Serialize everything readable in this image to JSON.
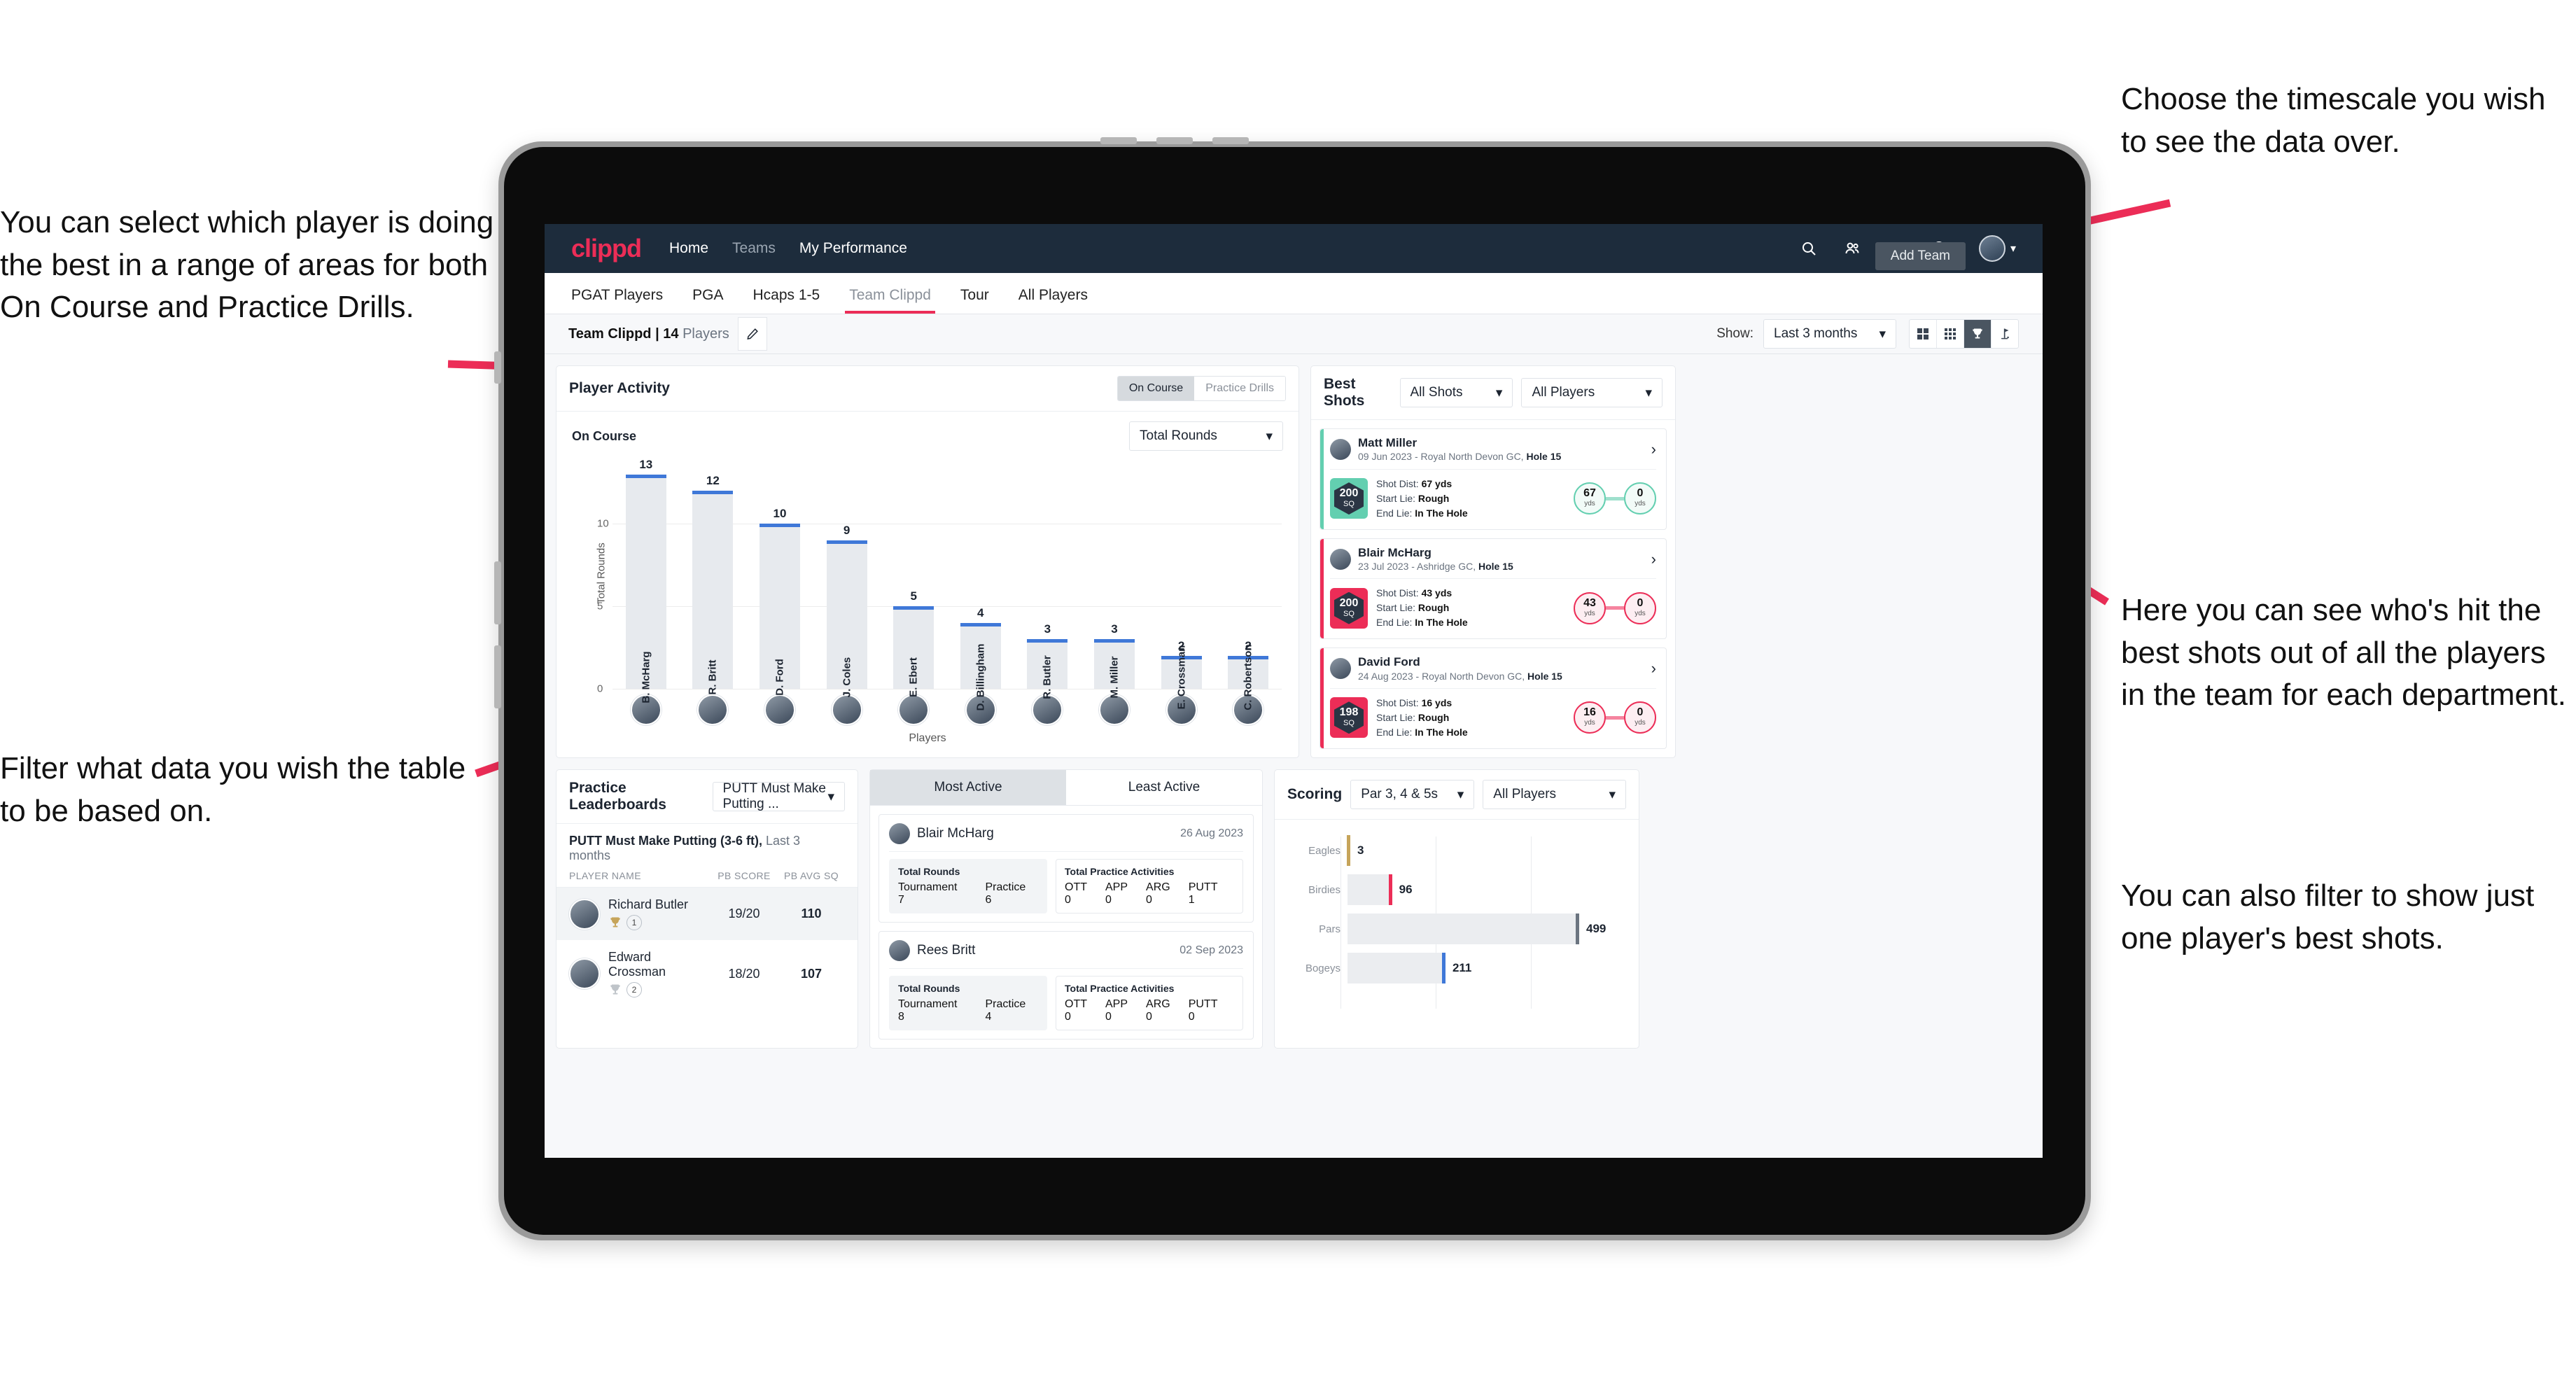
{
  "annotations": {
    "left_top": "You can select which player is doing the best in a range of areas for both On Course and Practice Drills.",
    "left_bottom": "Filter what data you wish the table to be based on.",
    "right_top": "Choose the timescale you wish to see the data over.",
    "right_mid": "Here you can see who's hit the best shots out of all the players in the team for each department.",
    "right_bottom": "You can also filter to show just one player's best shots."
  },
  "colors": {
    "brand": "#ec2d57",
    "navy": "#1d2c3c",
    "teal": "#63cfb0",
    "blue": "#3f78d8",
    "gold": "#c6a45a"
  },
  "topnav": {
    "brand": "clippd",
    "links": [
      {
        "label": "Home"
      },
      {
        "label": "Teams"
      },
      {
        "label": "My Performance"
      }
    ],
    "icons": [
      "search-icon",
      "people-icon",
      "bell-icon",
      "plus-circle-icon",
      "avatar"
    ]
  },
  "tabs": [
    {
      "label": "PGAT Players",
      "active": false
    },
    {
      "label": "PGA",
      "active": false
    },
    {
      "label": "Hcaps 1-5",
      "active": false
    },
    {
      "label": "Team Clippd",
      "active": true
    },
    {
      "label": "Tour",
      "active": false
    },
    {
      "label": "All Players",
      "active": false
    }
  ],
  "tooltip": {
    "add_team": "Add Team"
  },
  "subbar": {
    "team_name": "Team Clippd",
    "separator": "|",
    "player_count": "14",
    "players_word": "Players",
    "show_label": "Show:",
    "timescale_value": "Last 3 months",
    "view_icons": [
      "grid-4-icon",
      "grid-9-icon",
      "trophy-icon",
      "golf-flag-icon"
    ],
    "active_view": "trophy-icon"
  },
  "player_activity": {
    "title": "Player Activity",
    "segments": [
      {
        "label": "On Course",
        "active": true
      },
      {
        "label": "Practice Drills",
        "active": false
      }
    ],
    "sub_label": "On Course",
    "metric_select": "Total Rounds"
  },
  "chart_data": [
    {
      "type": "bar",
      "title": "Player Activity - On Course",
      "categories": [
        "B. McHarg",
        "R. Britt",
        "D. Ford",
        "J. Coles",
        "E. Ebert",
        "D. Billingham",
        "R. Butler",
        "M. Miller",
        "E. Crossman",
        "C. Robertson"
      ],
      "values": [
        13,
        12,
        10,
        9,
        5,
        4,
        3,
        3,
        2,
        2
      ],
      "xlabel": "Players",
      "ylabel": "Total Rounds",
      "ylim": [
        0,
        14
      ],
      "yticks": [
        0,
        5,
        10
      ],
      "grid": true,
      "legend": "none"
    },
    {
      "type": "bar",
      "orientation": "horizontal",
      "title": "Scoring",
      "categories": [
        "Eagles",
        "Birdies",
        "Pars",
        "Bogeys"
      ],
      "values": [
        3,
        96,
        499,
        211
      ],
      "colors": [
        "#c6a45a",
        "#ec2d57",
        "#6b7480",
        "#3f78d8"
      ],
      "xlabel": "",
      "ylabel": "",
      "xlim": [
        0,
        600
      ],
      "grid": true
    }
  ],
  "best_shots": {
    "title": "Best Shots",
    "shot_filter": "All Shots",
    "player_filter": "All Players",
    "shots": [
      {
        "accent": "teal",
        "player": "Matt Miller",
        "meta_date": "09 Jun 2023 - Royal North Devon GC,",
        "meta_hole": "Hole 15",
        "sq_value": "200",
        "sq_unit": "SQ",
        "shot_dist_label": "Shot Dist:",
        "shot_dist": "67 yds",
        "start_lie_label": "Start Lie:",
        "start_lie": "Rough",
        "end_lie_label": "End Lie:",
        "end_lie": "In The Hole",
        "from_value": "67",
        "from_unit": "yds",
        "to_value": "0",
        "to_unit": "yds"
      },
      {
        "accent": "pink",
        "player": "Blair McHarg",
        "meta_date": "23 Jul 2023 - Ashridge GC,",
        "meta_hole": "Hole 15",
        "sq_value": "200",
        "sq_unit": "SQ",
        "shot_dist_label": "Shot Dist:",
        "shot_dist": "43 yds",
        "start_lie_label": "Start Lie:",
        "start_lie": "Rough",
        "end_lie_label": "End Lie:",
        "end_lie": "In The Hole",
        "from_value": "43",
        "from_unit": "yds",
        "to_value": "0",
        "to_unit": "yds"
      },
      {
        "accent": "pink",
        "player": "David Ford",
        "meta_date": "24 Aug 2023 - Royal North Devon GC,",
        "meta_hole": "Hole 15",
        "sq_value": "198",
        "sq_unit": "SQ",
        "shot_dist_label": "Shot Dist:",
        "shot_dist": "16 yds",
        "start_lie_label": "Start Lie:",
        "start_lie": "Rough",
        "end_lie_label": "End Lie:",
        "end_lie": "In The Hole",
        "from_value": "16",
        "from_unit": "yds",
        "to_value": "0",
        "to_unit": "yds"
      }
    ]
  },
  "practice_leaderboards": {
    "title": "Practice Leaderboards",
    "drill_select": "PUTT Must Make Putting ...",
    "sub_title": "PUTT Must Make Putting (3-6 ft),",
    "sub_period": "Last 3 months",
    "columns": [
      "PLAYER NAME",
      "PB SCORE",
      "PB AVG SQ"
    ],
    "rows": [
      {
        "name": "Richard Butler",
        "rank": "1",
        "trophy": "gold",
        "pb_score": "19/20",
        "pb_avg_sq": "110",
        "highlight": true
      },
      {
        "name": "Edward Crossman",
        "rank": "2",
        "trophy": "silver",
        "pb_score": "18/20",
        "pb_avg_sq": "107",
        "highlight": false
      }
    ]
  },
  "activity": {
    "tabs": [
      {
        "label": "Most Active",
        "active": true
      },
      {
        "label": "Least Active",
        "active": false
      }
    ],
    "rounds_title": "Total Rounds",
    "practice_title": "Total Practice Activities",
    "rounds_keys": [
      "Tournament",
      "Practice"
    ],
    "practice_keys": [
      "OTT",
      "APP",
      "ARG",
      "PUTT"
    ],
    "players": [
      {
        "name": "Blair McHarg",
        "date": "26 Aug 2023",
        "rounds": [
          "7",
          "6"
        ],
        "practice": [
          "0",
          "0",
          "0",
          "1"
        ]
      },
      {
        "name": "Rees Britt",
        "date": "02 Sep 2023",
        "rounds": [
          "8",
          "4"
        ],
        "practice": [
          "0",
          "0",
          "0",
          "0"
        ]
      }
    ]
  },
  "scoring": {
    "title": "Scoring",
    "par_select": "Par 3, 4 & 5s",
    "player_select": "All Players"
  }
}
